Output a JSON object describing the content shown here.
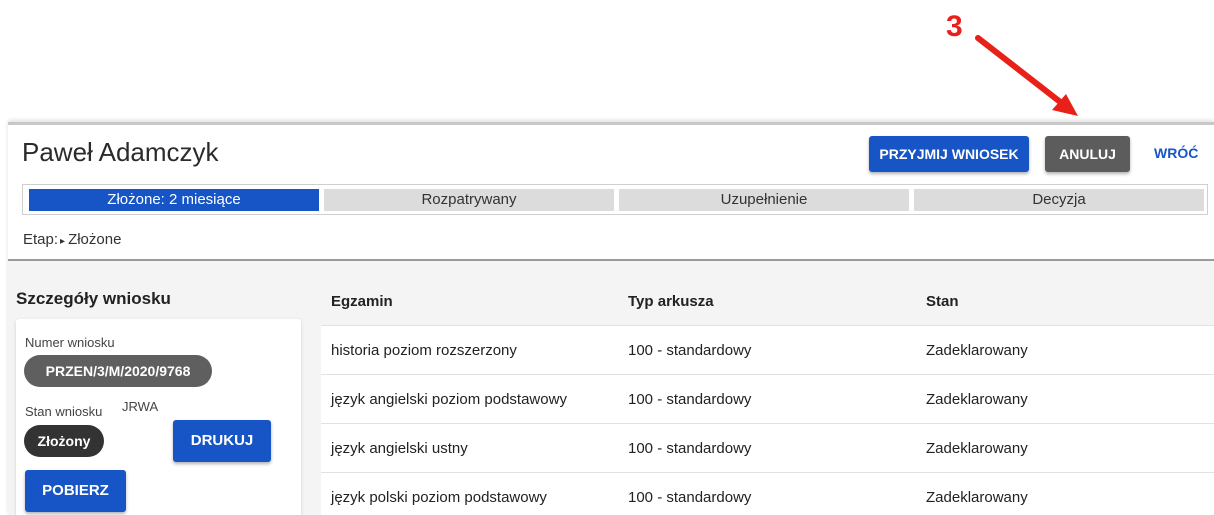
{
  "annotation": {
    "number": "3",
    "color": "#e8201a"
  },
  "header": {
    "title": "Paweł Adamczyk",
    "accept_label": "PRZYJMIJ WNIOSEK",
    "cancel_label": "ANULUJ",
    "back_label": "WRÓĆ"
  },
  "progress": {
    "steps": [
      {
        "label": "Złożone: 2 miesiące",
        "active": true
      },
      {
        "label": "Rozpatrywany",
        "active": false
      },
      {
        "label": "Uzupełnienie",
        "active": false
      },
      {
        "label": "Decyzja",
        "active": false
      }
    ]
  },
  "stage": {
    "prefix": "Etap:",
    "value": "Złożone"
  },
  "details": {
    "title": "Szczegóły wniosku",
    "number_label": "Numer wniosku",
    "number_value": "PRZEN/3/M/2020/9768",
    "status_label": "Stan wniosku",
    "status_code": "JRWA",
    "status_value": "Złożony",
    "print_label": "DRUKUJ",
    "download_label": "POBIERZ"
  },
  "table": {
    "headers": [
      "Egzamin",
      "Typ arkusza",
      "Stan"
    ],
    "rows": [
      [
        "historia poziom rozszerzony",
        "100 - standardowy",
        "Zadeklarowany"
      ],
      [
        "język angielski poziom podstawowy",
        "100 - standardowy",
        "Zadeklarowany"
      ],
      [
        "język angielski ustny",
        "100 - standardowy",
        "Zadeklarowany"
      ],
      [
        "język polski poziom podstawowy",
        "100 - standardowy",
        "Zadeklarowany"
      ]
    ]
  },
  "colors": {
    "primary": "#1755c6",
    "grey_button": "#5c5c5c",
    "status_chip": "#333333"
  }
}
